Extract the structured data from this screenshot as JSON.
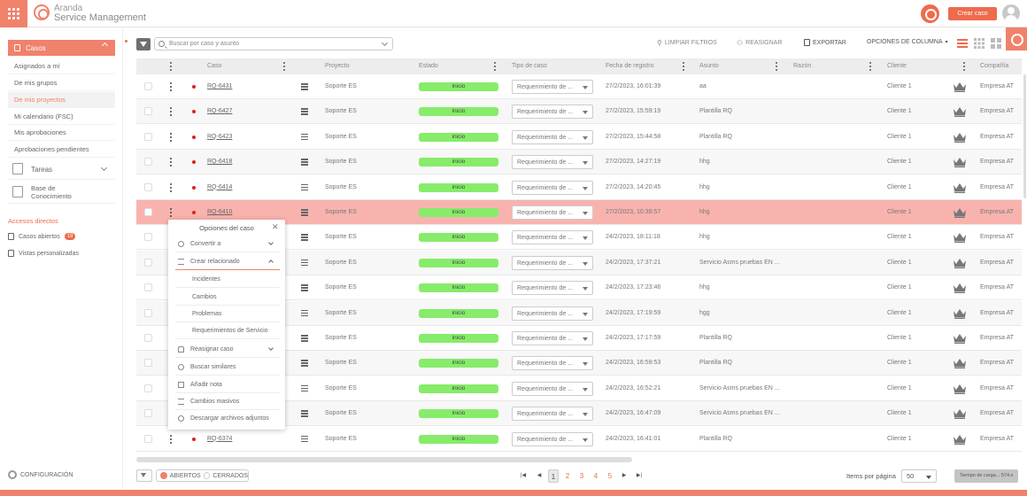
{
  "brand": {
    "line1": "Aranda",
    "line2": "Service Management"
  },
  "header": {
    "create_label": "Crear caso"
  },
  "colors": {
    "accent": "#f0826c",
    "button": "#ee6b4d",
    "status_pill": "#86ec6a",
    "highlight_row": "#f9b3ae",
    "dot_red": "#e0201a"
  },
  "sidebar": {
    "casos_label": "Casos",
    "items": [
      "Asignados a mí",
      "De mis grupos",
      "De mis proyectos",
      "Mi calendario (FSC)",
      "Mis aprobaciones",
      "Aprobaciones pendientes"
    ],
    "tareas_label": "Tareas",
    "base_line1": "Base de",
    "base_line2": "Conocimiento",
    "accesos_label": "Accesos directos",
    "casos_abiertos_label": "Casos abiertos",
    "casos_abiertos_count": "19",
    "vistas_label": "Vistas personalizadas",
    "config_label": "CONFIGURACIÓN"
  },
  "toolbar": {
    "search_placeholder": "Buscar por caso y asunto",
    "limpiar": "LIMPIAR FILTROS",
    "reasignar": "REASIGNAR",
    "exportar": "EXPORTAR",
    "opciones": "OPCIONES DE COLUMNA"
  },
  "columns": [
    "Caso",
    "Proyecto",
    "Estado",
    "Tipo de caso",
    "Fecha de registro",
    "Asunto",
    "Razón",
    "Cliente",
    "Compañía"
  ],
  "rows": [
    {
      "caso": "RQ-6431",
      "proyecto": "Soporte ES",
      "estado": "inicio",
      "tipo": "Requerimiento de ...",
      "fecha": "27/2/2023, 16:01:39",
      "asunto": "aa",
      "cliente": "Cliente 1",
      "compania": "Empresa AT"
    },
    {
      "caso": "RQ-6427",
      "proyecto": "Soporte ES",
      "estado": "inicio",
      "tipo": "Requerimiento de ...",
      "fecha": "27/2/2023, 15:59:19",
      "asunto": "Plantilla RQ",
      "cliente": "Cliente 1",
      "compania": "Empresa AT"
    },
    {
      "caso": "RQ-6423",
      "proyecto": "Soporte ES",
      "estado": "inicio",
      "tipo": "Requerimiento de ...",
      "fecha": "27/2/2023, 15:44:58",
      "asunto": "Plantilla RQ",
      "cliente": "Cliente 1",
      "compania": "Empresa AT"
    },
    {
      "caso": "RQ-6418",
      "proyecto": "Soporte ES",
      "estado": "inicio",
      "tipo": "Requerimiento de ...",
      "fecha": "27/2/2023, 14:27:19",
      "asunto": "hhg",
      "cliente": "Cliente 1",
      "compania": "Empresa AT"
    },
    {
      "caso": "RQ-6414",
      "proyecto": "Soporte ES",
      "estado": "inicio",
      "tipo": "Requerimiento de ...",
      "fecha": "27/2/2023, 14:20:45",
      "asunto": "hhg",
      "cliente": "Cliente 1",
      "compania": "Empresa AT"
    },
    {
      "caso": "RQ-6410",
      "proyecto": "Soporte ES",
      "estado": "inicio",
      "tipo": "Requerimiento de ...",
      "fecha": "27/2/2023, 10:39:57",
      "asunto": "hhg",
      "cliente": "Cliente 1",
      "compania": "Empresa AT"
    },
    {
      "caso": "",
      "proyecto": "Soporte ES",
      "estado": "inicio",
      "tipo": "Requerimiento de ...",
      "fecha": "24/2/2023, 18:11:18",
      "asunto": "hhg",
      "cliente": "Cliente 1",
      "compania": "Empresa AT"
    },
    {
      "caso": "",
      "proyecto": "Soporte ES",
      "estado": "inicio",
      "tipo": "Requerimiento de ...",
      "fecha": "24/2/2023, 17:37:21",
      "asunto": "Servicio Asms pruebas EN ...",
      "cliente": "Cliente 1",
      "compania": "Empresa AT"
    },
    {
      "caso": "",
      "proyecto": "Soporte ES",
      "estado": "inicio",
      "tipo": "Requerimiento de ...",
      "fecha": "24/2/2023, 17:23:46",
      "asunto": "hhg",
      "cliente": "Cliente 1",
      "compania": "Empresa AT"
    },
    {
      "caso": "",
      "proyecto": "Soporte ES",
      "estado": "inicio",
      "tipo": "Requerimiento de ...",
      "fecha": "24/2/2023, 17:19:59",
      "asunto": "hgg",
      "cliente": "Cliente 1",
      "compania": "Empresa AT"
    },
    {
      "caso": "",
      "proyecto": "Soporte ES",
      "estado": "inicio",
      "tipo": "Requerimiento de ...",
      "fecha": "24/2/2023, 17:17:59",
      "asunto": "Plantilla RQ",
      "cliente": "Cliente 1",
      "compania": "Empresa AT"
    },
    {
      "caso": "",
      "proyecto": "Soporte ES",
      "estado": "inicio",
      "tipo": "Requerimiento de ...",
      "fecha": "24/2/2023, 16:59:53",
      "asunto": "Plantilla RQ",
      "cliente": "Cliente 1",
      "compania": "Empresa AT"
    },
    {
      "caso": "",
      "proyecto": "Soporte ES",
      "estado": "inicio",
      "tipo": "Requerimiento de ...",
      "fecha": "24/2/2023, 16:52:21",
      "asunto": "Servicio Asms pruebas EN ...",
      "cliente": "Cliente 1",
      "compania": "Empresa AT"
    },
    {
      "caso": "",
      "proyecto": "Soporte ES",
      "estado": "inicio",
      "tipo": "Requerimiento de ...",
      "fecha": "24/2/2023, 16:47:09",
      "asunto": "Servicio Asms pruebas EN ...",
      "cliente": "Cliente 1",
      "compania": "Empresa AT"
    },
    {
      "caso": "RQ-6374",
      "proyecto": "Soporte ES",
      "estado": "inicio",
      "tipo": "Requerimiento de ...",
      "fecha": "24/2/2023, 16:41:01",
      "asunto": "Plantilla RQ",
      "cliente": "Cliente 1",
      "compania": "Empresa AT"
    }
  ],
  "context_menu": {
    "title": "Opciones del caso",
    "convertir": "Convertir a",
    "crear": "Crear relacionado",
    "sub": [
      "Incidentes",
      "Cambios",
      "Problemas",
      "Requerimientos de Servicio"
    ],
    "reasignar": "Reasignar caso",
    "buscar": "Buscar similares",
    "nota": "Añadir nota",
    "masivos": "Cambios masivos",
    "descargar": "Descargar archivos adjuntos"
  },
  "footer": {
    "abiertos": "ABIERTOS",
    "cerrados": "CERRADOS",
    "pages": [
      "1",
      "2",
      "3",
      "4",
      "5"
    ],
    "current_page": "1",
    "items_label": "Items por página",
    "items_value": "50",
    "timer": "Tiempo de carga... 574.x"
  }
}
